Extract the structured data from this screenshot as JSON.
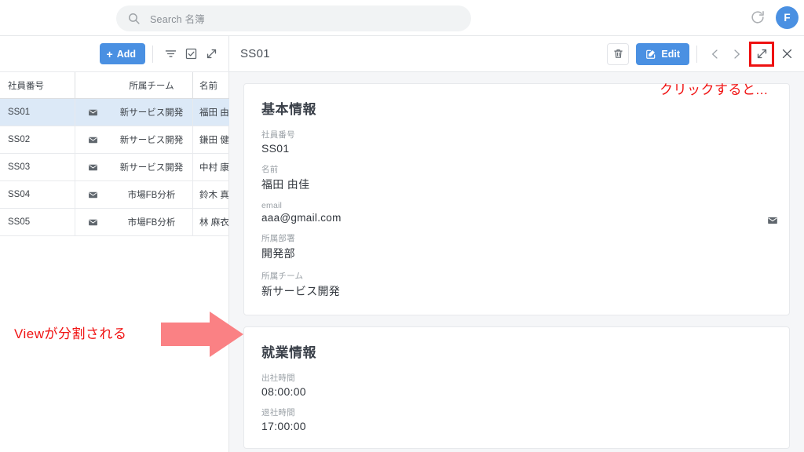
{
  "topbar": {
    "search": {
      "placeholder": "Search 名簿",
      "icon": "search-icon"
    },
    "refresh_icon": "refresh-icon",
    "avatar_initial": "F"
  },
  "left_toolbar": {
    "add_label": "Add",
    "add_plus": "+",
    "icons": [
      "filter-icon",
      "checkbox-icon",
      "expand-icon"
    ]
  },
  "table": {
    "columns": [
      "社員番号",
      "",
      "所属チーム",
      "名前"
    ],
    "rows": [
      {
        "id": "SS01",
        "mail_icon": "envelope-icon",
        "team": "新サービス開発",
        "name": "福田 由",
        "selected": true
      },
      {
        "id": "SS02",
        "mail_icon": "envelope-icon",
        "team": "新サービス開発",
        "name": "鎌田 健",
        "selected": false
      },
      {
        "id": "SS03",
        "mail_icon": "envelope-icon",
        "team": "新サービス開発",
        "name": "中村 康",
        "selected": false
      },
      {
        "id": "SS04",
        "mail_icon": "envelope-icon",
        "team": "市場FB分析",
        "name": "鈴木 真",
        "selected": false
      },
      {
        "id": "SS05",
        "mail_icon": "envelope-icon",
        "team": "市場FB分析",
        "name": "林 麻衣",
        "selected": false
      }
    ]
  },
  "detail": {
    "title": "SS01",
    "toolbar": {
      "delete_icon": "trash-icon",
      "edit_label": "Edit",
      "edit_icon": "pencil-square-icon",
      "prev_icon": "chevron-left-icon",
      "next_icon": "chevron-right-icon",
      "expand_icon": "expand-diagonal-icon",
      "close_icon": "close-icon"
    },
    "cards": [
      {
        "title": "基本情報",
        "fields": [
          {
            "label": "社員番号",
            "value": "SS01"
          },
          {
            "label": "名前",
            "value": "福田 由佳"
          },
          {
            "label": "email",
            "value": "aaa@gmail.com",
            "trailing_icon": "envelope-icon"
          },
          {
            "label": "所属部署",
            "value": "開発部"
          },
          {
            "label": "所属チーム",
            "value": "新サービス開発"
          }
        ]
      },
      {
        "title": "就業情報",
        "fields": [
          {
            "label": "出社時間",
            "value": "08:00:00"
          },
          {
            "label": "退社時間",
            "value": "17:00:00"
          }
        ]
      }
    ]
  },
  "annotations": {
    "right_text": "クリックすると...",
    "left_text": "Viewが分割される",
    "highlight_color": "#ee1111",
    "arrow_color": "#fa8184"
  }
}
